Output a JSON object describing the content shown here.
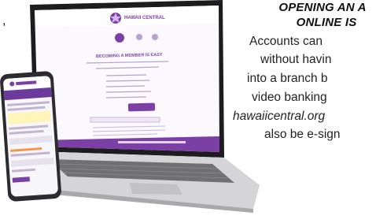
{
  "copy": {
    "heading_line1": "OPENING AN A",
    "heading_line2": "ONLINE IS",
    "body_lines": [
      "Accounts can",
      "without havin",
      "into a branch b",
      "video banking",
      "hawaiicentral.org",
      "also be e-sign"
    ]
  },
  "leading_comma": ",",
  "laptop_screen": {
    "brand": "HAWAII CENTRAL",
    "heading": "BECOMING A MEMBER IS EASY",
    "continue_label": "",
    "chat_label": ""
  },
  "colors": {
    "brand_purple": "#7b3fa6",
    "laptop_silver": "#c9c9cc",
    "phone_body": "#2b2b30"
  }
}
